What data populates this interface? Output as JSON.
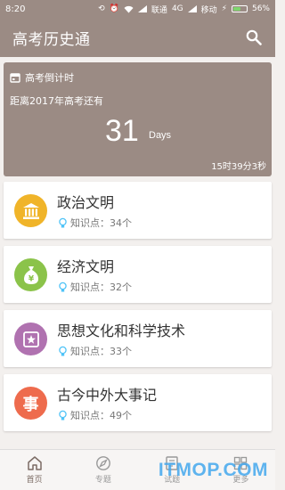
{
  "status_bar": {
    "time": "8:20",
    "carrier1": "联通",
    "network": "4G",
    "carrier2": "移动",
    "battery_percent": "56%",
    "battery_level": 0.56
  },
  "app_bar": {
    "title": "高考历史通",
    "search_icon": "search-icon"
  },
  "countdown": {
    "header": "高考倒计时",
    "subtitle": "距离2017年高考还有",
    "days": "31",
    "unit": "Days",
    "time_left": "15时39分3秒"
  },
  "cards": [
    {
      "title": "政治文明",
      "meta": "知识点：34个",
      "icon": "temple-icon",
      "color": "#f0b429"
    },
    {
      "title": "经济文明",
      "meta": "知识点：32个",
      "icon": "money-bag-icon",
      "color": "#8bc34a"
    },
    {
      "title": "思想文化和科学技术",
      "meta": "知识点：33个",
      "icon": "idea-star-icon",
      "color": "#b072b0"
    },
    {
      "title": "古今中外大事记",
      "meta": "知识点：49个",
      "icon": "event-icon",
      "glyph": "事",
      "color": "#ee6b4d"
    }
  ],
  "tabs": [
    {
      "label": "首页",
      "icon": "home-icon"
    },
    {
      "label": "专题",
      "icon": "compass-icon"
    },
    {
      "label": "试题",
      "icon": "exam-icon"
    },
    {
      "label": "更多",
      "icon": "grid-icon"
    }
  ],
  "watermark": "ITMOP.COM",
  "colors": {
    "primary": "#9b8b84",
    "background": "#f3f0ee",
    "bulb": "#4fc3f7"
  }
}
